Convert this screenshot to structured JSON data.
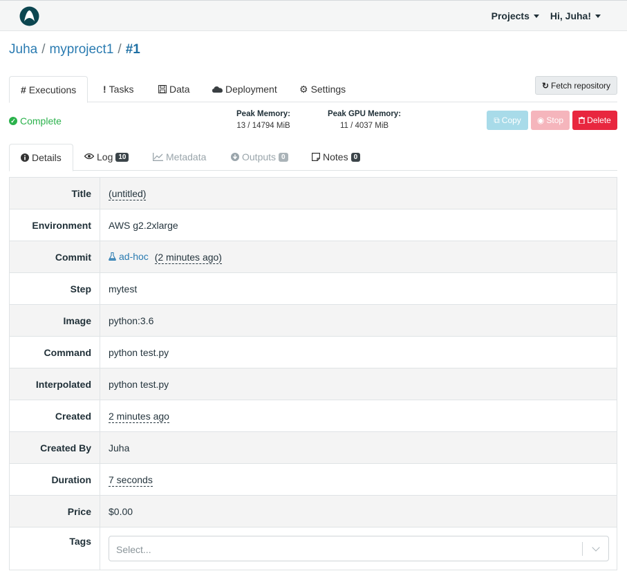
{
  "navbar": {
    "projects_label": "Projects",
    "user_label": "Hi, Juha!"
  },
  "breadcrumb": {
    "owner": "Juha",
    "project": "myproject1",
    "current": "#1",
    "separator": "/"
  },
  "main_tabs": [
    {
      "label": "Executions",
      "icon": "hash-icon"
    },
    {
      "label": "Tasks",
      "icon": "exclamation-icon"
    },
    {
      "label": "Data",
      "icon": "floppy-icon"
    },
    {
      "label": "Deployment",
      "icon": "cloud-icon"
    },
    {
      "label": "Settings",
      "icon": "gear-icon"
    }
  ],
  "fetch_button": {
    "label": "Fetch repository",
    "icon": "refresh-icon"
  },
  "status": {
    "label": "Complete",
    "color": "#2bb24c"
  },
  "peak_memory": {
    "label": "Peak Memory:",
    "value": "13 / 14794 MiB"
  },
  "peak_gpu_memory": {
    "label": "Peak GPU Memory:",
    "value": "11 / 4037 MiB"
  },
  "actions": {
    "copy": "Copy",
    "stop": "Stop",
    "delete": "Delete"
  },
  "sub_tabs": [
    {
      "label": "Details",
      "icon": "info-icon"
    },
    {
      "label": "Log",
      "badge": "10",
      "icon": "eye-icon"
    },
    {
      "label": "Metadata",
      "icon": "chart-icon"
    },
    {
      "label": "Outputs",
      "badge": "0",
      "icon": "download-icon"
    },
    {
      "label": "Notes",
      "badge": "0",
      "icon": "note-icon"
    }
  ],
  "details": {
    "title": {
      "key": "Title",
      "value": "(untitled)"
    },
    "environment": {
      "key": "Environment",
      "value": "AWS g2.2xlarge"
    },
    "commit": {
      "key": "Commit",
      "value": "ad-hoc",
      "time": "(2 minutes ago)"
    },
    "step": {
      "key": "Step",
      "value": "mytest"
    },
    "image": {
      "key": "Image",
      "value": "python:3.6"
    },
    "command": {
      "key": "Command",
      "value": "python test.py"
    },
    "interpolated": {
      "key": "Interpolated",
      "value": "python test.py"
    },
    "created": {
      "key": "Created",
      "value": "2 minutes ago"
    },
    "created_by": {
      "key": "Created By",
      "value": "Juha"
    },
    "duration": {
      "key": "Duration",
      "value": "7 seconds"
    },
    "price": {
      "key": "Price",
      "value": "$0.00"
    },
    "tags": {
      "key": "Tags",
      "placeholder": "Select..."
    }
  },
  "colors": {
    "copy": "#a8dbe9",
    "stop": "#f5b5bc",
    "delete": "#e8273f",
    "link": "#2a7bb1"
  }
}
